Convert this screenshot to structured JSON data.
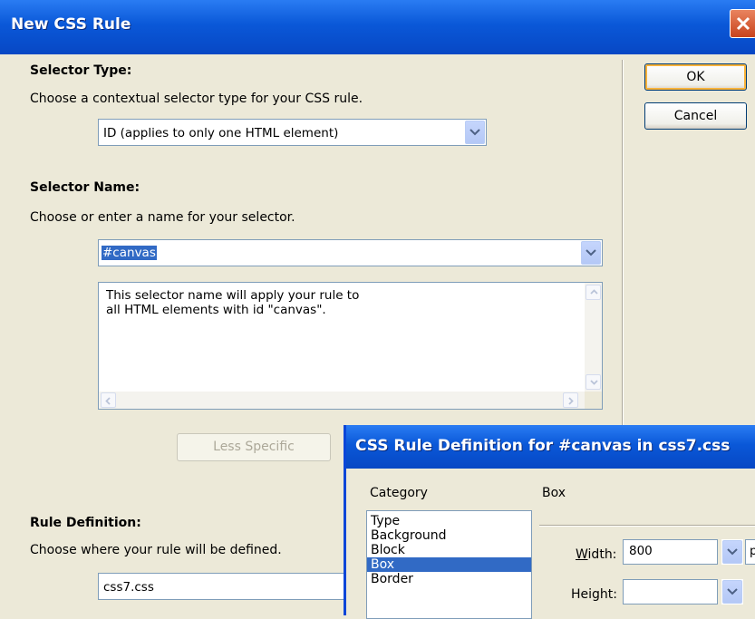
{
  "main_dialog": {
    "title": "New CSS Rule",
    "selector_type": {
      "heading": "Selector Type:",
      "description": "Choose a contextual selector type for your CSS rule.",
      "selected_value": "ID (applies to only one HTML element)"
    },
    "selector_name": {
      "heading": "Selector Name:",
      "description": "Choose or enter a name for your selector.",
      "input_value": "#canvas",
      "info_text": "This selector name will apply your rule to\nall HTML elements with id \"canvas\".",
      "less_specific_label": "Less Specific"
    },
    "rule_definition": {
      "heading": "Rule Definition:",
      "description": "Choose where your rule will be defined.",
      "selected_value": "css7.css"
    },
    "ok_label": "OK",
    "cancel_label": "Cancel"
  },
  "definition_dialog": {
    "title": "CSS Rule Definition for #canvas in css7.css",
    "category_label": "Category",
    "section_label": "Box",
    "categories": [
      "Type",
      "Background",
      "Block",
      "Box",
      "Border"
    ],
    "selected_category": "Box",
    "width_label_prefix": "W",
    "width_label_rest": "idth:",
    "width_value": "800",
    "height_label": "Height:",
    "height_value": "",
    "unit_partial": "p"
  },
  "colors": {
    "titlebar": "#0a58d8",
    "dialog_bg": "#ece9d8",
    "selection": "#316ac5"
  }
}
